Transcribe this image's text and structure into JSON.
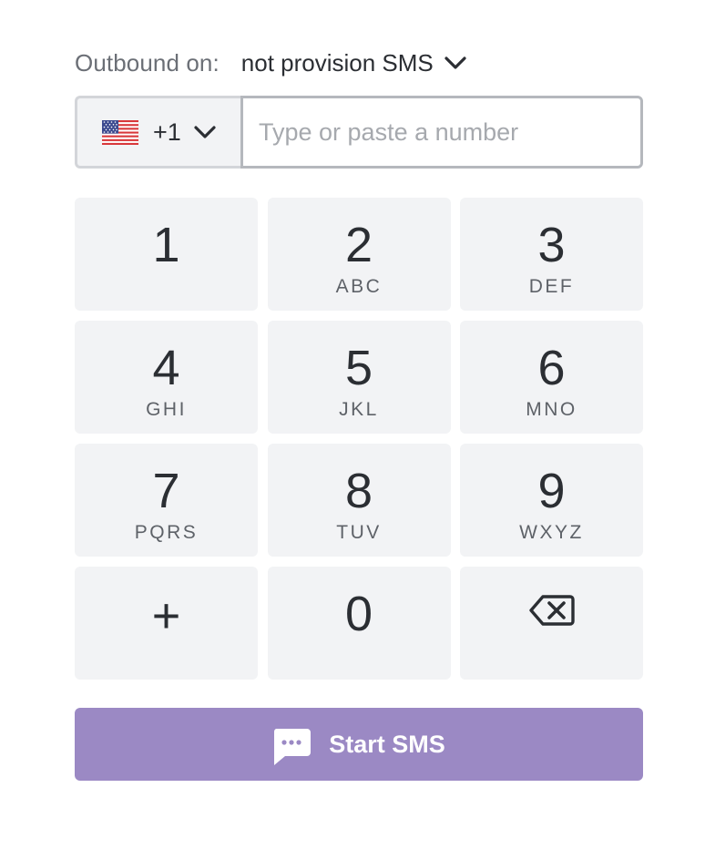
{
  "outbound": {
    "label": "Outbound on:",
    "value": "not provision SMS",
    "chevron_icon": "chevron-down-icon"
  },
  "phone": {
    "flag_icon": "us-flag-icon",
    "country_code": "+1",
    "chevron_icon": "chevron-down-icon",
    "input_value": "",
    "input_placeholder": "Type or paste a number"
  },
  "keypad": {
    "keys": [
      {
        "digit": "1",
        "letters": ""
      },
      {
        "digit": "2",
        "letters": "ABC"
      },
      {
        "digit": "3",
        "letters": "DEF"
      },
      {
        "digit": "4",
        "letters": "GHI"
      },
      {
        "digit": "5",
        "letters": "JKL"
      },
      {
        "digit": "6",
        "letters": "MNO"
      },
      {
        "digit": "7",
        "letters": "PQRS"
      },
      {
        "digit": "8",
        "letters": "TUV"
      },
      {
        "digit": "9",
        "letters": "WXYZ"
      },
      {
        "digit": "+",
        "letters": ""
      },
      {
        "digit": "0",
        "letters": ""
      }
    ],
    "backspace_icon": "backspace-icon"
  },
  "action": {
    "start_label": "Start SMS",
    "icon": "sms-bubble-icon"
  },
  "colors": {
    "accent": "#9b89c4",
    "key_bg": "#f2f3f5",
    "text": "#2b2e33",
    "muted": "#6b6f76"
  }
}
